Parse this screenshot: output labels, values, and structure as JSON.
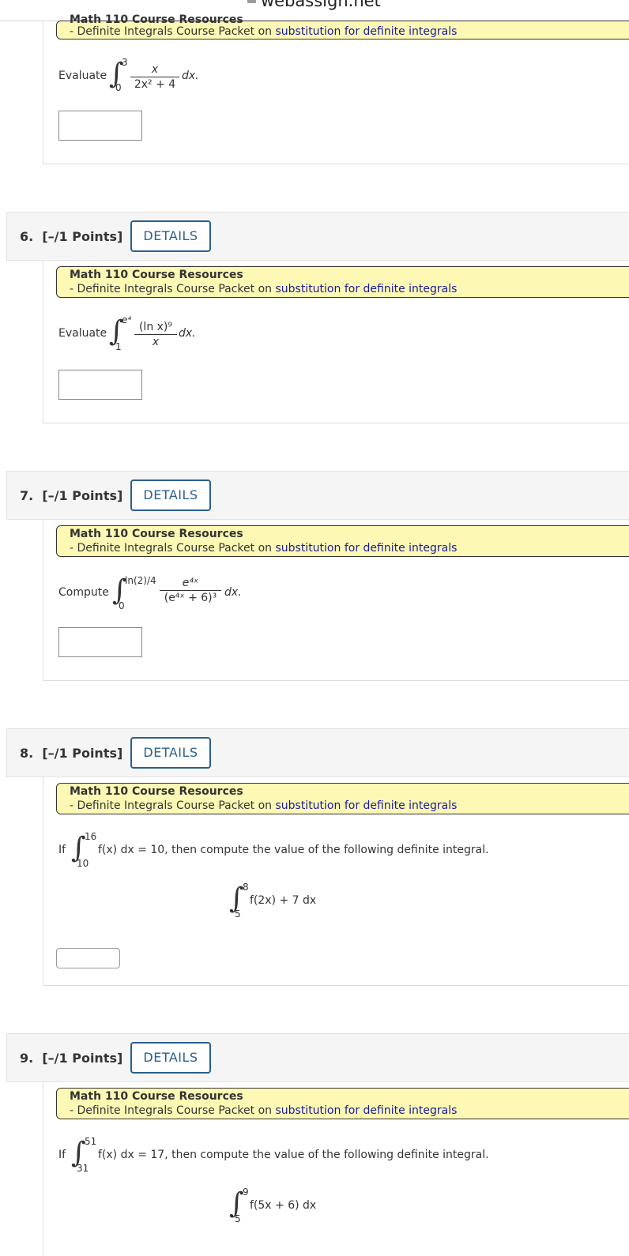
{
  "browser": {
    "url": "webassign.net"
  },
  "resources": {
    "title": "Math 110 Course Resources",
    "line_prefix": "- Definite Integrals Course Packet on ",
    "link": "substitution for definite integrals"
  },
  "q5": {
    "prompt": "Evaluate",
    "upper": "3",
    "lower": "0",
    "numerator": "x",
    "denominator": "2x² + 4",
    "tail": "dx."
  },
  "questions": [
    {
      "number": "6.",
      "points": "[–/1 Points]",
      "details_label": "DETAILS",
      "prompt": "Evaluate",
      "upper": "e⁴",
      "lower": "1",
      "numerator": "(ln x)⁹",
      "denominator": "x",
      "tail": "dx."
    },
    {
      "number": "7.",
      "points": "[–/1 Points]",
      "details_label": "DETAILS",
      "prompt": "Compute",
      "upper": "ln(2)/4",
      "lower": "0",
      "numerator": "e⁴ˣ",
      "denominator": "(e⁴ˣ + 6)³",
      "tail": "dx."
    },
    {
      "number": "8.",
      "points": "[–/1 Points]",
      "details_label": "DETAILS",
      "if_label": "If",
      "given_upper": "16",
      "given_lower": "10",
      "given_integrand": "f(x) dx = 10, then compute the value of the following definite integral.",
      "target_upper": "8",
      "target_lower": "5",
      "target_integrand": "f(2x) + 7 dx"
    },
    {
      "number": "9.",
      "points": "[–/1 Points]",
      "details_label": "DETAILS",
      "if_label": "If",
      "given_upper": "51",
      "given_lower": "31",
      "given_integrand": "f(x) dx = 17, then compute the value of the following definite integral.",
      "target_upper": "9",
      "target_lower": "5",
      "target_integrand": "f(5x + 6) dx"
    }
  ]
}
